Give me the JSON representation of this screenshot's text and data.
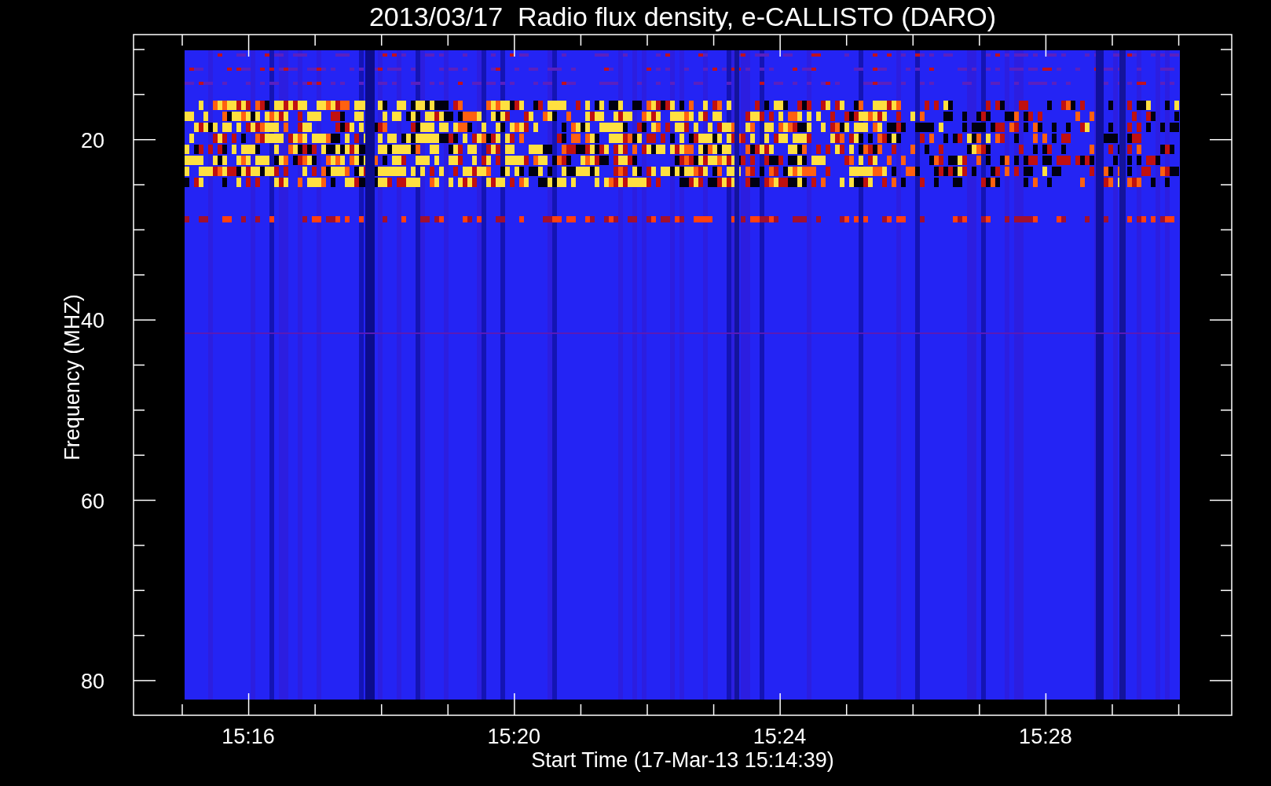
{
  "title": "2013/03/17  Radio flux density, e-CALLISTO (DARO)",
  "plot": {
    "ylabel": "Frequency (MHZ)",
    "xlabel": "Start Time (17-Mar-13 15:14:39)",
    "yticks": [
      "20",
      "40",
      "60",
      "80"
    ],
    "xticks": [
      "15:16",
      "15:20",
      "15:24",
      "15:28"
    ]
  }
}
